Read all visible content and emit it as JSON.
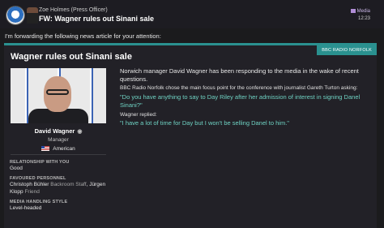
{
  "header": {
    "sender": "Zoe Holmes  (Press Officer)",
    "subject": "FW: Wagner rules out Sinani sale",
    "tag": "Media",
    "time": "12:23"
  },
  "intro": "I'm forwarding the following news article for your attention:",
  "article": {
    "source": "BBC RADIO NORFOLK",
    "title": "Wagner rules out Sinani sale",
    "paragraph": "Norwich manager David Wagner has been responding to the media in the wake of recent questions.",
    "context": "BBC Radio Norfolk chose the main focus point for the conference with journalist Gareth Turton asking:",
    "question": "\"Do you have anything to say to Day Riley after her admission of interest in signing Danel Sinani?\"",
    "reply_label": "Wagner replied:",
    "answer": "\"I have a lot of time for Day but I won't be selling Danel to him.\""
  },
  "profile": {
    "name": "David Wagner",
    "role": "Manager",
    "nationality": "American",
    "relationship_label": "RELATIONSHIP WITH YOU",
    "relationship_value": "Good",
    "favoured_label": "FAVOURED PERSONNEL",
    "favoured_1_name": "Christoph Bühler",
    "favoured_1_role": "Backroom Staff",
    "favoured_sep": ",",
    "favoured_2_name_a": "Jürgen",
    "favoured_2_name_b": "Klopp",
    "favoured_2_role": "Friend",
    "media_label": "MEDIA HANDLING STYLE",
    "media_value": "Level-headed"
  },
  "colors": {
    "accent": "#2a918f",
    "quote": "#6fd2c3",
    "media_tag": "#b08dd6"
  },
  "icons": [
    "club-badge-icon",
    "media-icon",
    "eye-icon",
    "usa-flag-icon"
  ]
}
